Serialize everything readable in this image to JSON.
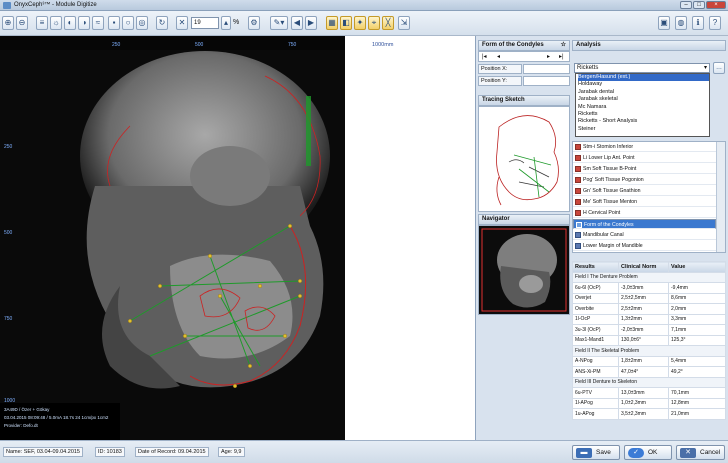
{
  "window": {
    "title": "OnyxCeph³™ - Module Digitize",
    "controls": [
      "–",
      "□",
      "×"
    ]
  },
  "toolbar": {
    "zoom_value": "19",
    "unit_symbol": "%"
  },
  "image": {
    "ruler_labels": [
      "250",
      "500",
      "750",
      "1000mm"
    ],
    "side_ruler_labels": [
      "250",
      "500",
      "750",
      "1000"
    ],
    "info_lines": [
      "3A49D / Özer + Gökay",
      "03.04.2015 08:09:48 / 5.0mA 18.7s 24 1cm/px 1cm2",
      "Provider: Defo.dt"
    ]
  },
  "condyles": {
    "header": "Form of the Condyles",
    "pin": "☆",
    "position_x_label": "Position X:",
    "position_y_label": "Position Y:"
  },
  "tracing": {
    "header": "Tracing Sketch"
  },
  "navigator": {
    "header": "Navigator"
  },
  "analysis": {
    "header": "Analysis",
    "selected": "Ricketts",
    "options": [
      "Bergen/Hasund (ext.)",
      "Holdaway",
      "Jarabak dental",
      "Jarabak skeletal",
      "Mc Namara",
      "Ricketts",
      "Ricketts - Short Analysis",
      "Steiner"
    ],
    "landmarks": [
      "Stm-i Stomion Inferior",
      "Li Lower Lip Ant. Point",
      "Sm Soft Tissue B-Point",
      "Pog' Soft Tissue Pogonion",
      "Gn' Soft Tissue Gnathion",
      "Me' Soft Tissue Menton",
      "H Cervical Point",
      "Form of the Condyles",
      "Mandibular Canal",
      "Lower Margin of Mandible"
    ]
  },
  "results": {
    "headers": [
      "Results",
      "Clinical Norm",
      "Value"
    ],
    "rows": [
      {
        "group": "Field I The Denture Problem"
      },
      {
        "name": "6u-6l (OcP)",
        "norm": "-3,0±3mm",
        "value": "-9,4mm"
      },
      {
        "name": "Overjet",
        "norm": "2,5±2,5mm",
        "value": "8,6mm"
      },
      {
        "name": "Overbite",
        "norm": "2,5±2mm",
        "value": "2,0mm"
      },
      {
        "name": "1l-OcP",
        "norm": "1,3±2mm",
        "value": "3,3mm"
      },
      {
        "name": "3u-3l (OcP)",
        "norm": "-2,0±3mm",
        "value": "7,1mm"
      },
      {
        "name": "Max1-Mand1",
        "norm": "130,0±6°",
        "value": "125,3°"
      },
      {
        "group": "Field II The Skeletal Problem"
      },
      {
        "name": "A-NPog",
        "norm": "1,8±2mm",
        "value": "5,4mm"
      },
      {
        "name": "ANS-Xi-PM",
        "norm": "47,0±4°",
        "value": "49,2°"
      },
      {
        "group": "Field III Denture to Skeleton"
      },
      {
        "name": "6u-PTV",
        "norm": "13,0±3mm",
        "value": "70,1mm"
      },
      {
        "name": "1l-APog",
        "norm": "1,0±2,3mm",
        "value": "12,8mm"
      },
      {
        "name": "1u-APog",
        "norm": "3,5±2,3mm",
        "value": "21,0mm"
      }
    ]
  },
  "status": {
    "name": "Name: SEF, 03.04-09.04.2015",
    "id": "ID: 10183",
    "record": "Date of Record: 09.04.2015",
    "age": "Age: 9,9"
  },
  "buttons": {
    "save": "Save",
    "ok": "OK",
    "cancel": "Cancel"
  }
}
